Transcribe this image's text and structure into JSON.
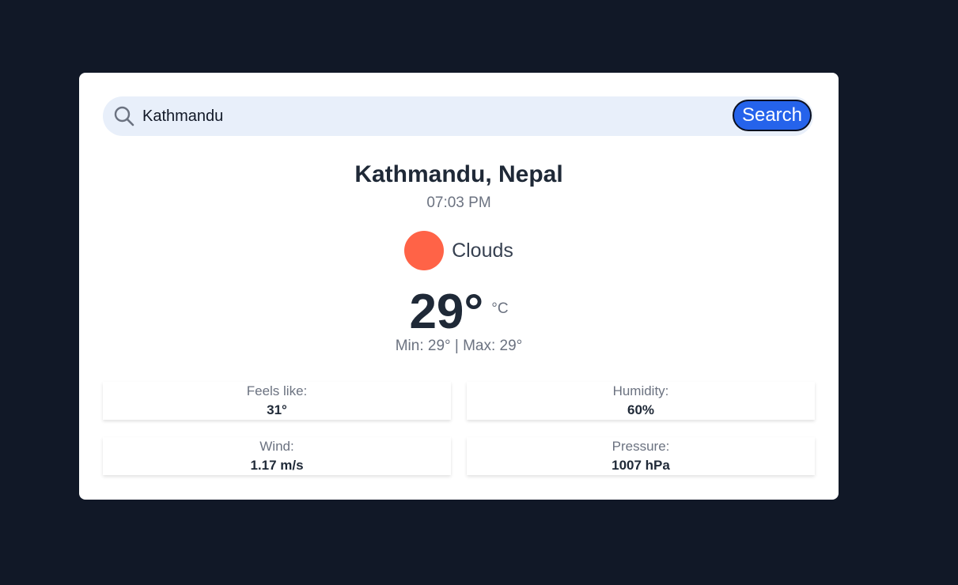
{
  "search": {
    "value": "Kathmandu",
    "button_label": "Search"
  },
  "location": "Kathmandu, Nepal",
  "time": "07:03 PM",
  "condition": {
    "icon": "condition-icon",
    "icon_color": "#ff6347",
    "label": "Clouds"
  },
  "temperature": {
    "value": "29°",
    "unit": "°C",
    "min_max": "Min: 29° | Max: 29°"
  },
  "stats": {
    "feels_like": {
      "label": "Feels like:",
      "value": "31°"
    },
    "humidity": {
      "label": "Humidity:",
      "value": "60%"
    },
    "wind": {
      "label": "Wind:",
      "value": "1.17 m/s"
    },
    "pressure": {
      "label": "Pressure:",
      "value": "1007 hPa"
    }
  },
  "colors": {
    "page_background": "#111827",
    "card_background": "#ffffff",
    "search_background": "#e8effa",
    "accent": "#2563eb"
  }
}
